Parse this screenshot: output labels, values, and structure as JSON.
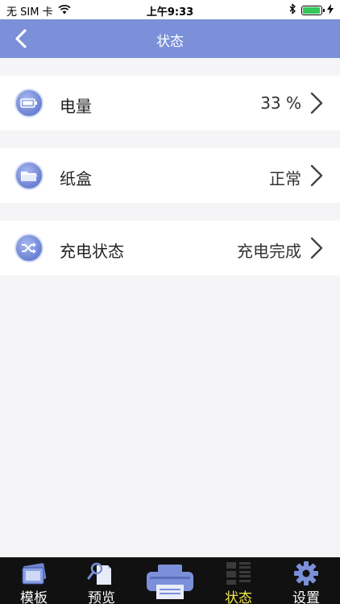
{
  "status_bar": {
    "carrier": "无 SIM 卡",
    "time": "上午9:33",
    "battery_level": 0.95,
    "battery_color": "#34c759"
  },
  "nav": {
    "title": "状态",
    "back_icon": "chevron-left-icon",
    "color": "#7b90d8"
  },
  "rows": [
    {
      "label": "电量",
      "value": "33 %",
      "icon": "battery-icon"
    },
    {
      "label": "纸盒",
      "value": "正常",
      "icon": "folder-icon"
    },
    {
      "label": "充电状态",
      "value": "充电完成",
      "icon": "shuffle-icon"
    }
  ],
  "tabs": [
    {
      "label": "模板",
      "icon": "template-icon"
    },
    {
      "label": "预览",
      "icon": "preview-icon"
    },
    {
      "label": "状态",
      "icon": "status-grid-icon",
      "active": true
    },
    {
      "label": "设置",
      "icon": "gear-icon"
    }
  ],
  "print_button": {
    "icon": "printer-icon"
  },
  "accent_colors": {
    "active_tab": "#f3e84a",
    "icon_blue": "#7b90d8"
  }
}
